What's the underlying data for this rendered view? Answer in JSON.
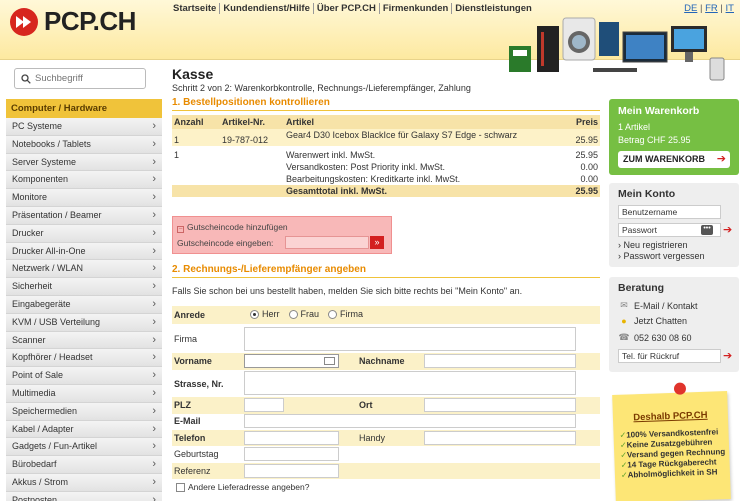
{
  "header": {
    "logo_text": "PCP.CH",
    "nav": [
      "Startseite",
      "Kundendienst/Hilfe",
      "Über PCP.CH",
      "Firmenkunden",
      "Dienstleistungen"
    ],
    "languages": [
      "DE",
      "FR",
      "IT"
    ]
  },
  "search": {
    "placeholder": "Suchbegriff"
  },
  "sidebar": {
    "category": "Computer / Hardware",
    "items": [
      "PC Systeme",
      "Notebooks / Tablets",
      "Server Systeme",
      "Komponenten",
      "Monitore",
      "Präsentation / Beamer",
      "Drucker",
      "Drucker All-in-One",
      "Netzwerk / WLAN",
      "Sicherheit",
      "Eingabegeräte",
      "KVM / USB Verteilung",
      "Scanner",
      "Kopfhörer / Headset",
      "Point of Sale",
      "Multimedia",
      "Speichermedien",
      "Kabel / Adapter",
      "Gadgets / Fun-Artikel",
      "Bürobedarf",
      "Akkus / Strom",
      "Postposten"
    ]
  },
  "main": {
    "title": "Kasse",
    "step": "Schritt 2 von 2: Warenkorbkontrolle, Rechnungs-/Lieferempfänger, Zahlung",
    "section1": "1. Bestellpositionen kontrollieren",
    "table": {
      "headers": {
        "qty": "Anzahl",
        "art": "Artikel-Nr.",
        "desc": "Artikel",
        "price": "Preis"
      },
      "item": {
        "qty": "1",
        "art": "19-787-012",
        "desc": "Gear4 D30 Icebox BlackIce für Galaxy S7 Edge - schwarz",
        "price": "25.95"
      },
      "summary": {
        "qty": "1",
        "rows": [
          {
            "label": "Warenwert inkl. MwSt.",
            "value": "25.95"
          },
          {
            "label": "Versandkosten: Post Priority inkl. MwSt.",
            "value": "0.00"
          },
          {
            "label": "Bearbeitungskosten: Kreditkarte inkl. MwSt.",
            "value": "0.00"
          }
        ],
        "total_label": "Gesamttotal inkl. MwSt.",
        "total_value": "25.95"
      }
    },
    "voucher": {
      "toggle": "Gutscheincode hinzufügen",
      "label": "Gutscheincode eingeben:"
    },
    "section2": "2. Rechnungs-/Lieferempfänger angeben",
    "login_hint": "Falls Sie schon bei uns bestellt haben, melden Sie sich bitte rechts bei \"Mein Konto\" an.",
    "form": {
      "anrede": "Anrede",
      "salutations": [
        "Herr",
        "Frau",
        "Firma"
      ],
      "firma": "Firma",
      "vorname": "Vorname",
      "nachname": "Nachname",
      "strasse": "Strasse, Nr.",
      "plz": "PLZ",
      "ort": "Ort",
      "email": "E-Mail",
      "telefon": "Telefon",
      "handy": "Handy",
      "geburtstag": "Geburtstag",
      "referenz": "Referenz",
      "other_address": "Andere Lieferadresse angeben?"
    }
  },
  "cart": {
    "title": "Mein Warenkorb",
    "count": "1 Artikel",
    "amount": "Betrag CHF 25.95",
    "button": "ZUM WARENKORB"
  },
  "account": {
    "title": "Mein Konto",
    "username_placeholder": "Benutzername",
    "password_placeholder": "Passwort",
    "register": "Neu registrieren",
    "forgot": "Passwort vergessen"
  },
  "support": {
    "title": "Beratung",
    "email": "E-Mail / Kontakt",
    "chat": "Jetzt Chatten",
    "phone": "052 630 08 60",
    "callback": "Tel. für Rückruf"
  },
  "promo": {
    "title": "Deshalb PCP.CH",
    "points": [
      "100% Versandkostenfrei",
      "Keine Zusatzgebühren",
      "Versand gegen Rechnung",
      "14 Tage Rückgaberecht",
      "Abholmöglichkeit in SH"
    ]
  },
  "colors": {
    "accent": "#e88b00",
    "brand_red": "#d7261e",
    "cart_green": "#76bf43",
    "category": "#f0c33a"
  }
}
